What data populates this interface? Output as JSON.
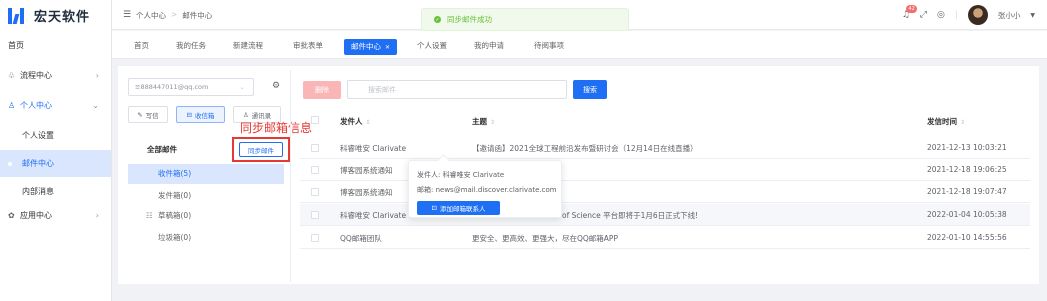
{
  "app": {
    "name": "宏天软件",
    "brand_color": "#1f6ff4"
  },
  "sidebar": {
    "items": [
      {
        "label": "首页",
        "icon": ""
      },
      {
        "label": "流程中心",
        "icon": "flow-icon",
        "arrow": "›"
      },
      {
        "label": "个人中心",
        "icon": "user-icon",
        "arrow": "⌄"
      },
      {
        "label": "个人设置"
      },
      {
        "label": "邮件中心"
      },
      {
        "label": "内部消息"
      },
      {
        "label": "应用中心",
        "icon": "app-icon",
        "arrow": "›"
      }
    ]
  },
  "header": {
    "breadcrumb": [
      "个人中心",
      "邮件中心"
    ],
    "breadcrumb_sep": ">",
    "toast": "同步邮件成功",
    "notification_count": "42",
    "username": "张小小"
  },
  "tabs": [
    "首页",
    "我的任务",
    "新建流程",
    "审批表单",
    "邮件中心",
    "个人设置",
    "我的申请",
    "待阅事项"
  ],
  "mail": {
    "account": "≡888447011@qq.com",
    "write_label": "写信",
    "inbox_btn_label": "收信箱",
    "contacts_label": "通讯录",
    "all_mail": "全部邮件",
    "sync_btn": "同步邮件",
    "sync_callout": "同步邮箱信息",
    "folders": [
      "收件箱(5)",
      "发件箱(0)",
      "草稿箱(0)",
      "垃圾箱(0)"
    ],
    "delete_btn": "删除",
    "search_placeholder": "搜索邮件",
    "search_btn": "搜索",
    "columns": {
      "sender": "发件人",
      "subject": "主题",
      "time": "发信时间"
    },
    "rows": [
      {
        "sender": "科睿唯安 Clarivate",
        "subject": "【邀请函】2021全球工程前沿发布暨研讨会（12月14日在线直播）",
        "time": "2021-12-13 10:03:21"
      },
      {
        "sender": "博客园系统通知",
        "subject": "",
        "time": "2021-12-18 19:06:25"
      },
      {
        "sender": "博客园系统通知",
        "subject": "",
        "time": "2021-12-18 19:07:47"
      },
      {
        "sender": "科睿唯安 Clarivate",
        "subject": "of Science 平台即将于1月6日正式下线!",
        "time": "2022-01-04 10:05:38"
      },
      {
        "sender": "QQ邮箱团队",
        "subject": "更安全、更高效、更强大，尽在QQ邮箱APP",
        "time": "2022-01-10 14:55:56"
      }
    ],
    "popover": {
      "sender_line": "发件人: 科睿唯安 Clarivate",
      "email_line": "邮箱: news@mail.discover.clarivate.com",
      "add_btn": "添加邮箱联系人"
    }
  }
}
